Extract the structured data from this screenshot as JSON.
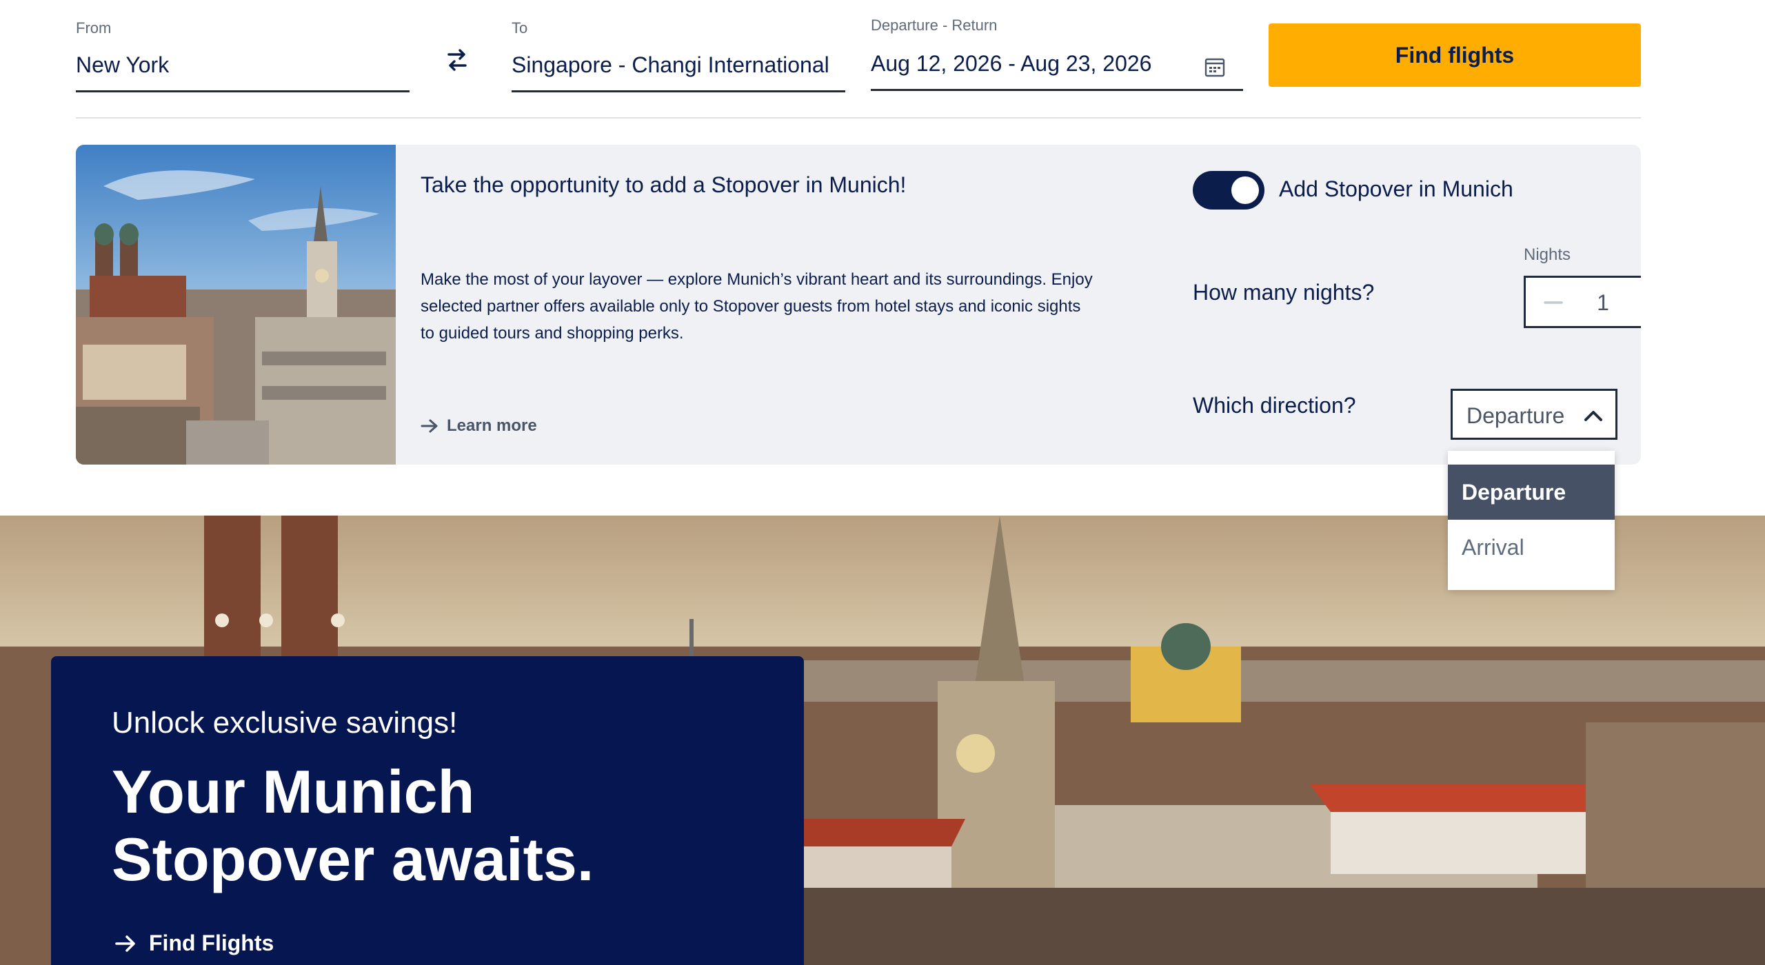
{
  "search": {
    "from_label": "From",
    "from_value": "New York",
    "to_label": "To",
    "to_value": "Singapore - Changi International",
    "dates_label": "Departure - Return",
    "dates_value": "Aug 12, 2026 - Aug 23, 2026",
    "find_button": "Find flights"
  },
  "stopover": {
    "title": "Take the opportunity to add a Stopover in Munich!",
    "description": "Make the most of your layover — explore Munich’s vibrant heart and its surroundings. Enjoy selected partner offers available only to Stopover guests from hotel stays and iconic sights to guided tours and shopping perks.",
    "learn_more": "Learn more",
    "toggle_label": "Add Stopover in Munich",
    "toggle_on": true,
    "nights_question": "How many nights?",
    "nights_label": "Nights",
    "nights_value": "1",
    "direction_question": "Which direction?",
    "direction_selected": "Departure",
    "direction_options": [
      "Departure",
      "Arrival"
    ]
  },
  "hero": {
    "subtitle": "Unlock exclusive savings!",
    "headline": "Your Munich Stopover awaits.",
    "cta": "Find Flights"
  },
  "colors": {
    "navy": "#0b1d4b",
    "promo_navy": "#061651",
    "accent_yellow": "#ffad00",
    "card_bg": "#f0f1f5",
    "selected_option": "#465166"
  },
  "icons": {
    "swap": "swap-arrows-icon",
    "calendar": "calendar-icon",
    "arrow": "arrow-right-icon",
    "minus": "minus-icon",
    "plus": "plus-icon",
    "chevron": "chevron-up-icon"
  }
}
